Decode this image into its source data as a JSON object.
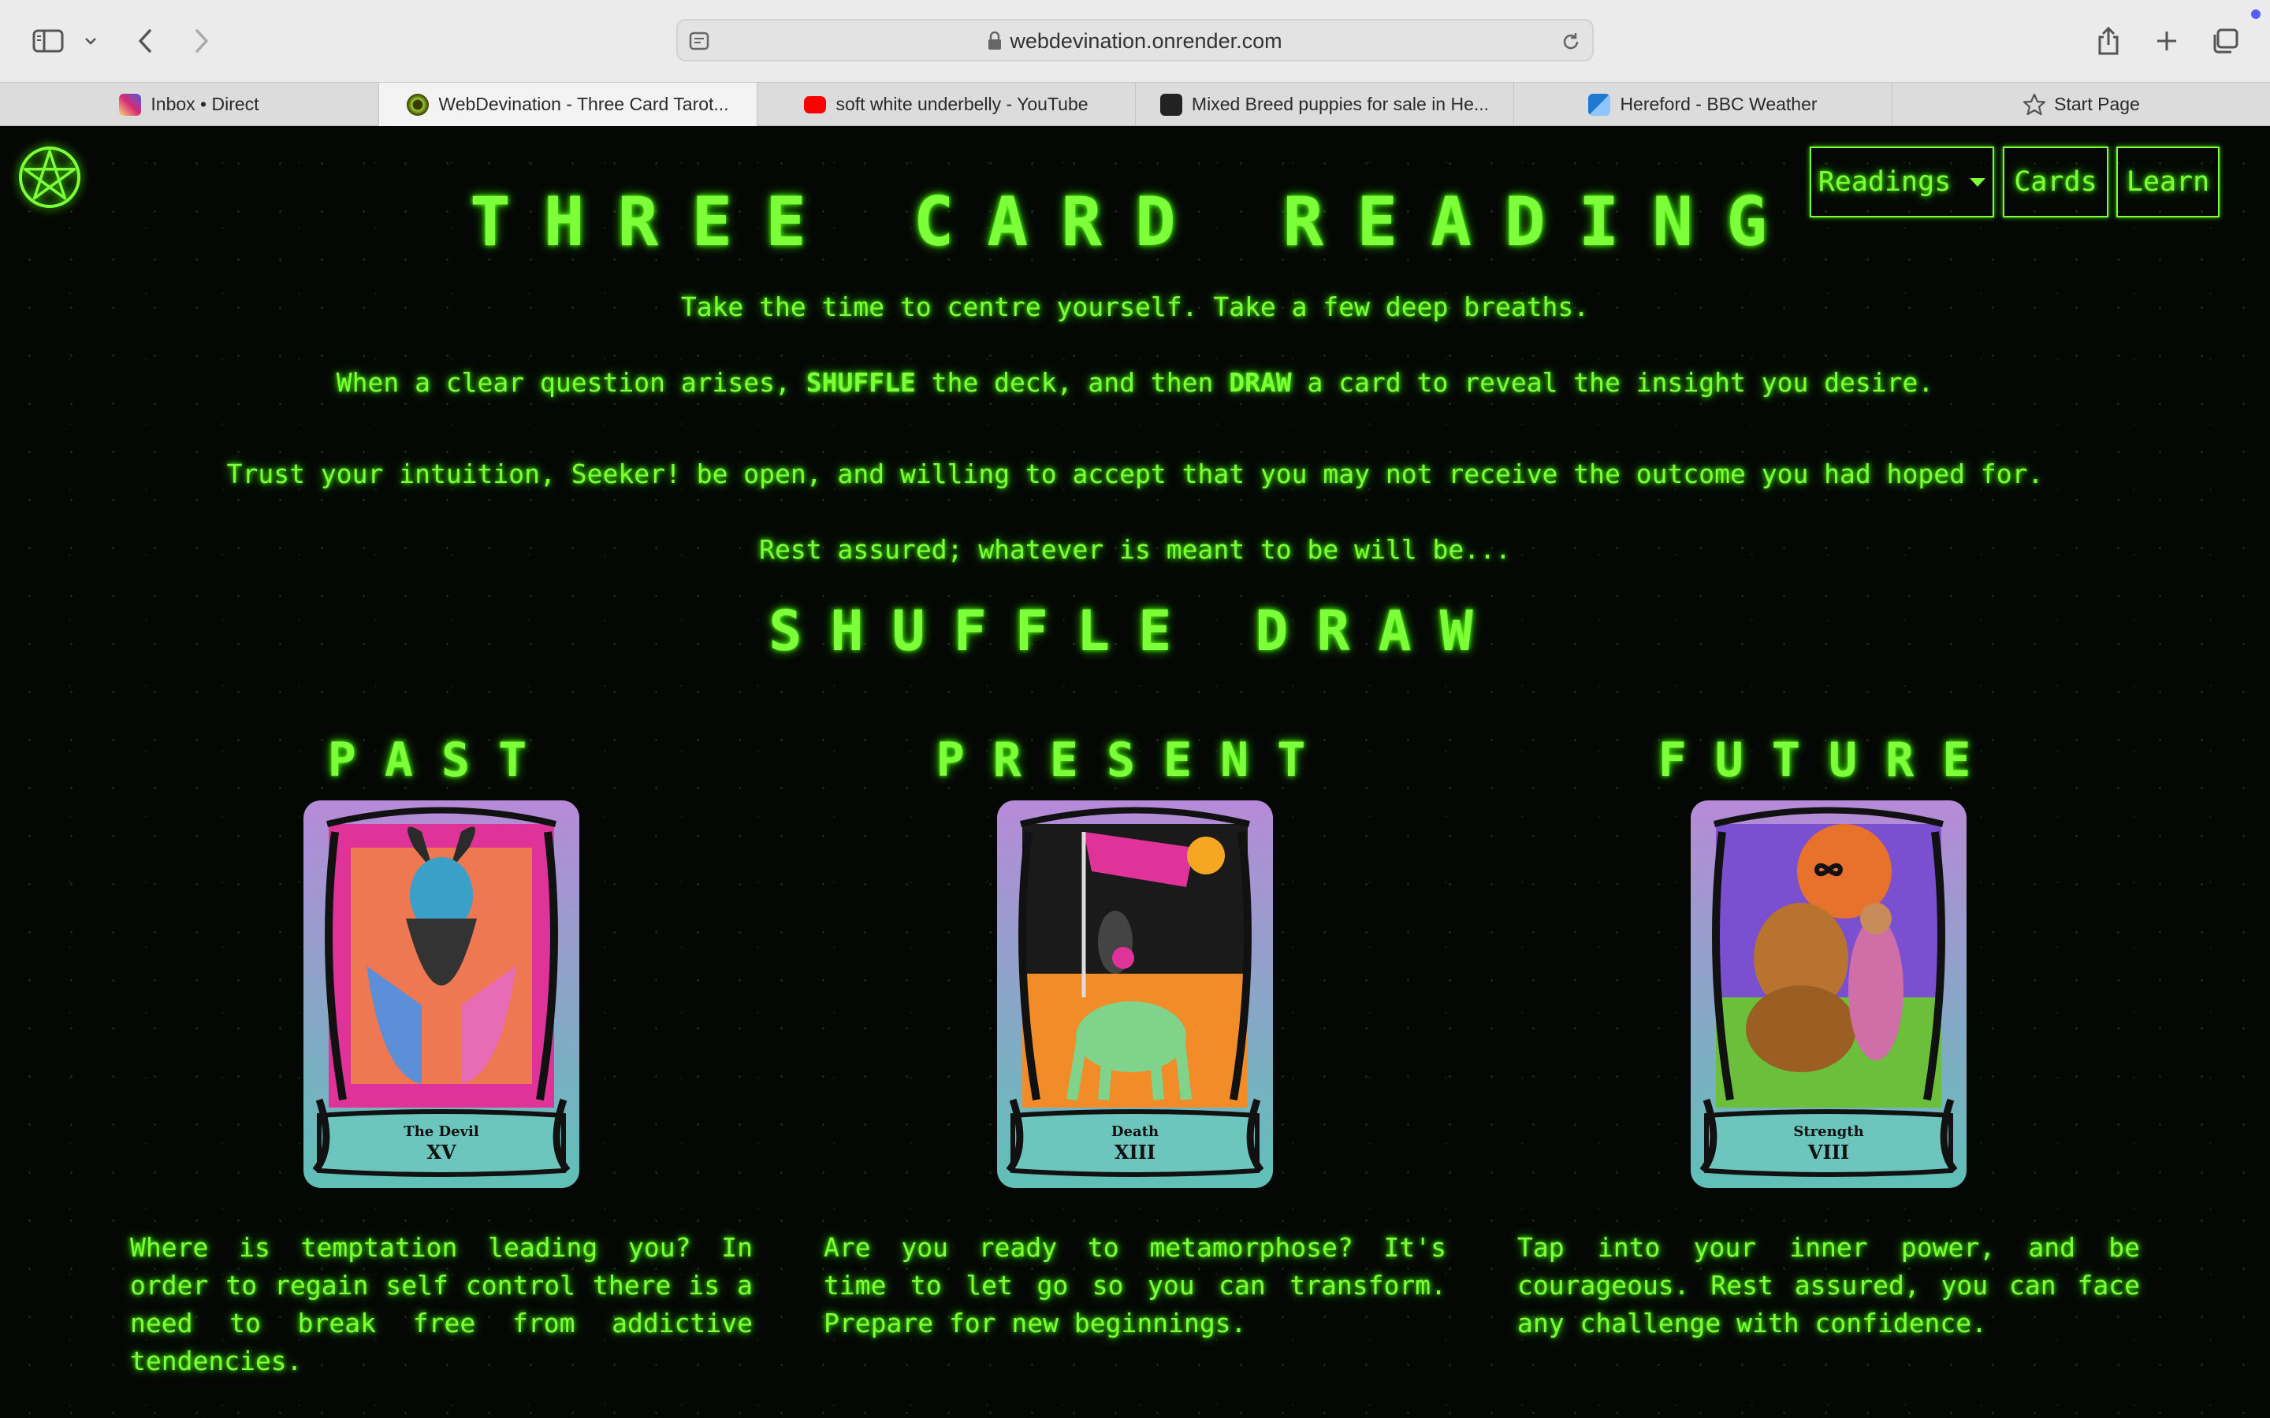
{
  "browser": {
    "url": "webdevination.onrender.com",
    "tabs": [
      {
        "label": "Inbox • Direct",
        "icon": "instagram-icon",
        "color": "#d62976",
        "active": false
      },
      {
        "label": "WebDevination - Three Card Tarot...",
        "icon": "site-favicon",
        "color": "#6b8e23",
        "active": true
      },
      {
        "label": "soft white underbelly - YouTube",
        "icon": "youtube-icon",
        "color": "#ff0000",
        "active": false
      },
      {
        "label": "Mixed Breed puppies for sale in He...",
        "icon": "dog-icon",
        "color": "#222222",
        "active": false
      },
      {
        "label": "Hereford - BBC Weather",
        "icon": "bbc-weather-icon",
        "color": "#1f78d1",
        "active": false
      },
      {
        "label": "Start Page",
        "icon": "star-icon",
        "color": "#555555",
        "active": false
      }
    ]
  },
  "nav": {
    "readings": "Readings",
    "cards": "Cards",
    "learn": "Learn"
  },
  "page": {
    "title": "THREE CARD READING",
    "intro1": "Take the time to centre yourself. Take a few deep breaths.",
    "intro2_a": "When a clear question arises, ",
    "intro2_shuffle": "SHUFFLE",
    "intro2_b": " the deck, and then ",
    "intro2_draw": "DRAW",
    "intro2_c": " a card to reveal the insight you desire.",
    "intro3": "Trust your intuition, Seeker! be open, and willing to accept that you may not receive the outcome you had hoped for.",
    "intro4": "Rest assured; whatever is meant to be will be...",
    "shuffle": "SHUFFLE",
    "draw": "DRAW"
  },
  "spread": [
    {
      "position": "PAST",
      "card_name": "The Devil",
      "numeral": "XV",
      "description": "Where is temptation leading you? In order to regain self control there is a need to break free from addictive tendencies."
    },
    {
      "position": "PRESENT",
      "card_name": "Death",
      "numeral": "XIII",
      "description": "Are you ready to metamorphose? It's time to let go so you can transform. Prepare for new beginnings."
    },
    {
      "position": "FUTURE",
      "card_name": "Strength",
      "numeral": "VIII",
      "description": "Tap into your inner power, and be courageous. Rest assured, you can face any challenge with confidence."
    }
  ],
  "colors": {
    "neon": "#7dff3a",
    "background": "#050705"
  }
}
